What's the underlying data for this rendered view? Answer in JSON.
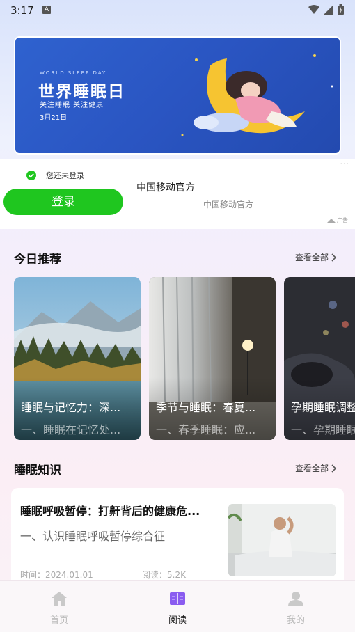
{
  "status_bar": {
    "time": "3:17",
    "notification_letter": "A"
  },
  "banner": {
    "english": "WORLD SLEEP DAY",
    "title": "世界睡眠日",
    "subtitle": "关注睡眠  关注健康",
    "date": "3月21日"
  },
  "ad": {
    "not_logged_in": "您还未登录",
    "login_button": "登录",
    "title": "中国移动官方",
    "subtitle": "中国移动官方",
    "more": "···",
    "tag": "广告"
  },
  "recommend": {
    "title": "今日推荐",
    "view_all": "查看全部",
    "cards": [
      {
        "title": "睡眠与记忆力：深...",
        "subtitle": "一、睡眠在记忆处..."
      },
      {
        "title": "季节与睡眠：春夏...",
        "subtitle": "一、春季睡眠：应..."
      },
      {
        "title": "孕期睡眠调整",
        "subtitle": "一、孕期睡眠"
      }
    ]
  },
  "knowledge": {
    "title": "睡眠知识",
    "view_all": "查看全部",
    "article": {
      "title": "睡眠呼吸暂停：打鼾背后的健康危...",
      "subtitle": "一、认识睡眠呼吸暂停综合征",
      "time": "时间：2024.01.01",
      "views": "阅读：5.2K"
    }
  },
  "tabs": [
    {
      "label": "首页",
      "icon": "home-icon"
    },
    {
      "label": "阅读",
      "icon": "book-icon"
    },
    {
      "label": "我的",
      "icon": "user-icon"
    }
  ],
  "colors": {
    "accent": "#1fc61f",
    "active_tab": "#8a5cf0"
  }
}
